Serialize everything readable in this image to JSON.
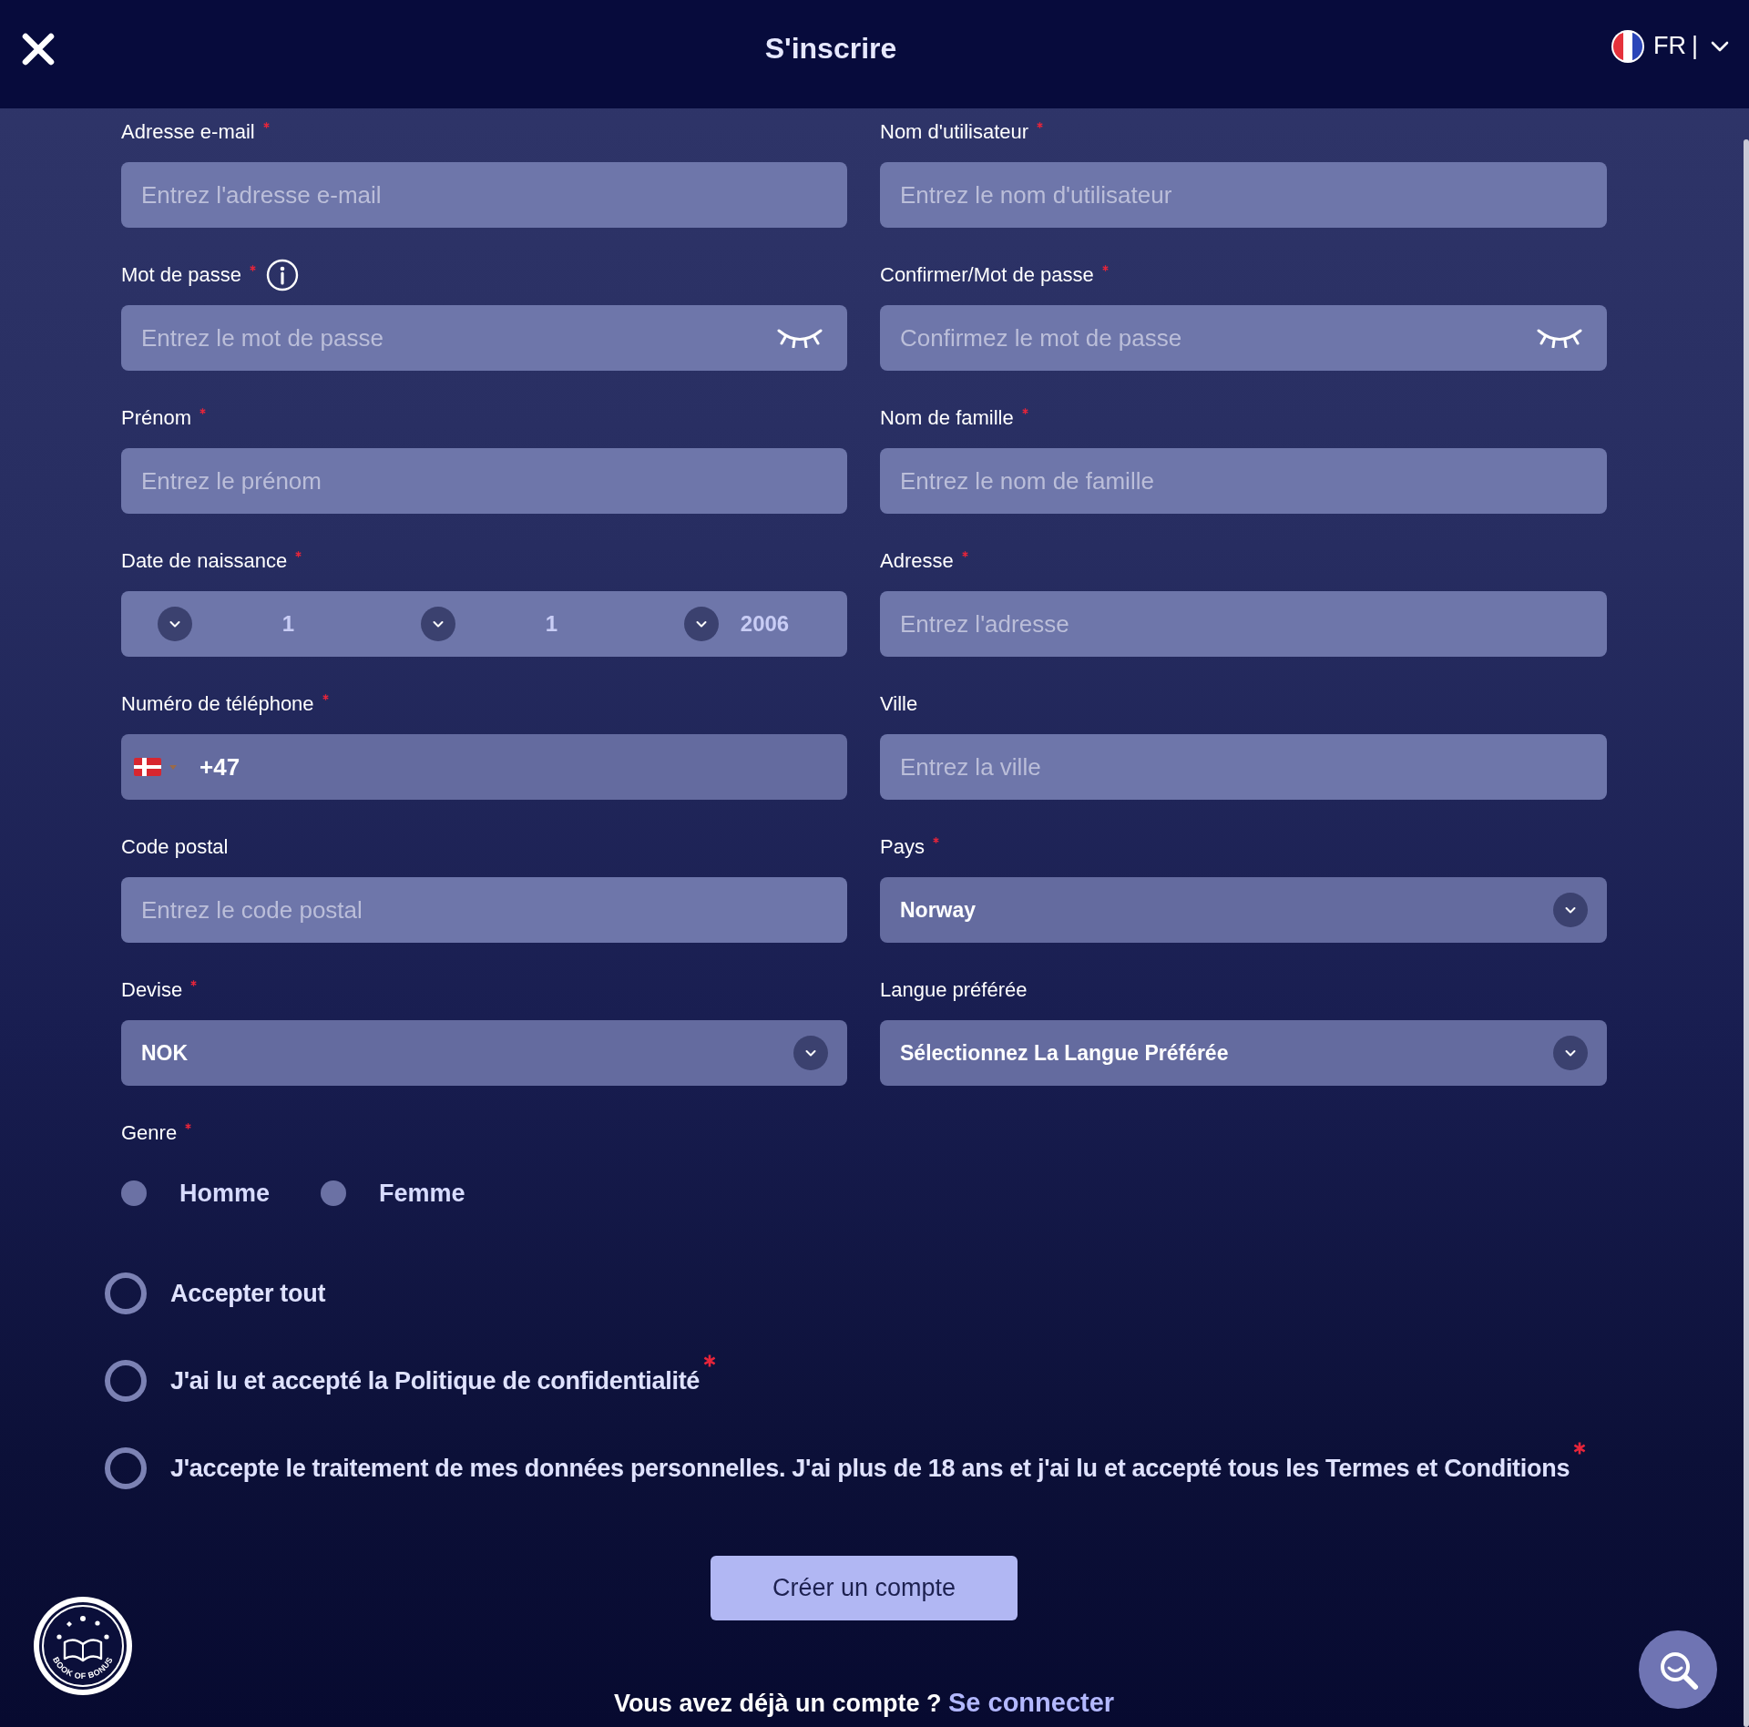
{
  "header": {
    "title": "S'inscrire",
    "language": {
      "code": "FR",
      "separator": "|"
    }
  },
  "fields": [
    {
      "kind": "text",
      "label": "Adresse e-mail",
      "required": true,
      "placeholder": "Entrez l'adresse e-mail"
    },
    {
      "kind": "text",
      "label": "Nom d'utilisateur",
      "required": true,
      "placeholder": "Entrez le nom d'utilisateur"
    },
    {
      "kind": "password",
      "label": "Mot de passe",
      "required": true,
      "info": true,
      "placeholder": "Entrez le mot de passe"
    },
    {
      "kind": "password",
      "label": "Confirmer/Mot de passe",
      "required": true,
      "placeholder": "Confirmez le mot de passe"
    },
    {
      "kind": "text",
      "label": "Prénom",
      "required": true,
      "placeholder": "Entrez le prénom"
    },
    {
      "kind": "text",
      "label": "Nom de famille",
      "required": true,
      "placeholder": "Entrez le nom de famille"
    },
    {
      "kind": "date",
      "label": "Date de naissance",
      "required": true,
      "parts": [
        {
          "value": "1"
        },
        {
          "value": "1"
        },
        {
          "value": "2006"
        }
      ]
    },
    {
      "kind": "text",
      "label": "Adresse",
      "required": true,
      "placeholder": "Entrez l'adresse"
    },
    {
      "kind": "phone",
      "label": "Numéro de téléphone",
      "required": true,
      "value": "+47"
    },
    {
      "kind": "text",
      "label": "Ville",
      "required": false,
      "placeholder": "Entrez la ville"
    },
    {
      "kind": "text",
      "label": "Code postal",
      "required": false,
      "placeholder": "Entrez le code postal"
    },
    {
      "kind": "select",
      "label": "Pays",
      "required": true,
      "value": "Norway"
    },
    {
      "kind": "select",
      "label": "Devise",
      "required": true,
      "value": "NOK"
    },
    {
      "kind": "select",
      "label": "Langue préférée",
      "required": false,
      "value": "Sélectionnez La Langue Préférée"
    }
  ],
  "gender": {
    "label": "Genre",
    "required": true,
    "options": [
      {
        "label": "Homme",
        "selected": false
      },
      {
        "label": "Femme",
        "selected": false
      }
    ]
  },
  "consents": [
    {
      "label": "Accepter tout",
      "checked": false,
      "required": false
    },
    {
      "label": "J'ai lu et accepté la Politique de confidentialité",
      "checked": false,
      "required": true
    },
    {
      "label": "J'accepte le traitement de mes données personnelles. J'ai plus de 18 ans et j'ai lu et accepté tous les Termes et Conditions",
      "checked": false,
      "required": true
    }
  ],
  "submit": {
    "label": "Créer un compte"
  },
  "login_prompt": {
    "text": "Vous avez déjà un compte ?",
    "link": "Se connecter"
  },
  "logo": {
    "text": "BOOK OF BONUS"
  }
}
